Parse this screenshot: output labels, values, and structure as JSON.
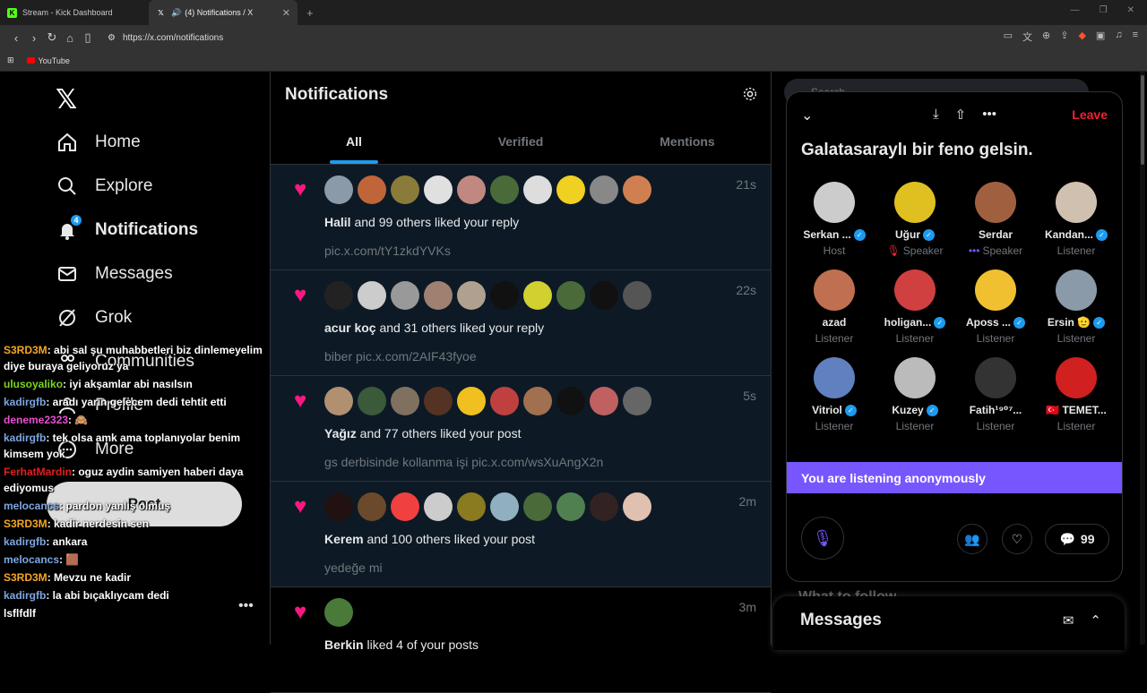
{
  "browser": {
    "tabs": [
      {
        "title": "Stream - Kick Dashboard",
        "favicon": "K",
        "favicon_color": "#53fc18"
      },
      {
        "title": "(4) Notifications / X",
        "favicon": "X",
        "favicon_color": "#ffffff"
      }
    ],
    "url": "https://x.com/notifications",
    "bookmark": "YouTube"
  },
  "nav": {
    "items": [
      {
        "label": "Home",
        "icon": "home-icon"
      },
      {
        "label": "Explore",
        "icon": "search-icon"
      },
      {
        "label": "Notifications",
        "icon": "bell-icon"
      },
      {
        "label": "Messages",
        "icon": "mail-icon"
      },
      {
        "label": "Grok",
        "icon": "grok-icon"
      },
      {
        "label": "Communities",
        "icon": "people-icon"
      },
      {
        "label": "Profile",
        "icon": "person-icon"
      },
      {
        "label": "More",
        "icon": "more-icon"
      }
    ],
    "notif_badge": "4",
    "post_label": "Post"
  },
  "chat": [
    {
      "user": "S3RD3M",
      "color": "#f5a623",
      "msg": ": abi sal şu muhabbetleri biz dinlemeyelim diye buraya geliyoruz ya"
    },
    {
      "user": "ulusoyaliko",
      "color": "#7ed321",
      "msg": ": iyi akşamlar abi nasılsın"
    },
    {
      "user": "kadirgfb",
      "color": "#7ea6e0",
      "msg": ": aradı yarın gelecem dedi tehtit etti"
    },
    {
      "user": "deneme2323",
      "color": "#e94fd1",
      "msg": ": 🙈"
    },
    {
      "user": "kadirgfb",
      "color": "#7ea6e0",
      "msg": ": tek olsa amk ama toplanıyolar benim kimsem yok"
    },
    {
      "user": "FerhatMardin",
      "color": "#e02020",
      "msg": ": oguz aydin samiyen haberi daya ediyomus"
    },
    {
      "user": "melocancs",
      "color": "#7ea6e0",
      "msg": ": pardon yanlış olmuş"
    },
    {
      "user": "S3RD3M",
      "color": "#f5a623",
      "msg": ": kadir nerdesin sen"
    },
    {
      "user": "kadirgfb",
      "color": "#7ea6e0",
      "msg": ": ankara"
    },
    {
      "user": "melocancs",
      "color": "#7ea6e0",
      "msg": ": 🟫"
    },
    {
      "user": "S3RD3M",
      "color": "#f5a623",
      "msg": ": Mevzu ne kadir"
    },
    {
      "user": "kadirgfb",
      "color": "#7ea6e0",
      "msg": ": la abi bıçaklıycam dedi"
    },
    {
      "user": "",
      "color": "#ffffff",
      "msg": "lsflfdlf"
    }
  ],
  "main": {
    "title": "Notifications",
    "tabs": [
      "All",
      "Verified",
      "Mentions"
    ],
    "notifications": [
      {
        "name": "Halil",
        "rest": " and 99 others liked your reply",
        "sub": "pic.x.com/tY1zkdYVKs",
        "time": "21s",
        "avatars": [
          "#8a9aa8",
          "#c0653a",
          "#8a7b3a",
          "#e0e0e0",
          "#c08880",
          "#4a6a3a",
          "#ddd",
          "#f0d020",
          "#888",
          "#d08050"
        ]
      },
      {
        "name": "acur koç",
        "rest": " and 31 others liked your reply",
        "sub": "biber pic.x.com/2AIF43fyoe",
        "time": "22s",
        "avatars": [
          "#222",
          "#ccc",
          "#999",
          "#a08070",
          "#b0a090",
          "#111",
          "#d0d030",
          "#4a6a3a",
          "#111",
          "#555"
        ]
      },
      {
        "name": "Yağız",
        "rest": " and 77 others liked your post",
        "sub": "gs derbisinde kollanma işi pic.x.com/wsXuAngX2n",
        "time": "5s",
        "avatars": [
          "#b09070",
          "#3a5a3a",
          "#807060",
          "#553322",
          "#f0c020",
          "#c04040",
          "#a07050",
          "#111",
          "#c06060",
          "#666"
        ]
      },
      {
        "name": "Kerem",
        "rest": " and 100 others liked your post",
        "sub": "yedeğe mi",
        "time": "2m",
        "avatars": [
          "#221111",
          "#6a4a2a",
          "#f04040",
          "#ccc",
          "#8a7a20",
          "#90b0c0",
          "#4a6a3a",
          "#508050",
          "#332222",
          "#e0c0b0"
        ]
      },
      {
        "name": "Berkin",
        "rest": " liked 4 of your posts",
        "sub": "",
        "time": "3m",
        "avatars": [
          "#4a7a3a"
        ]
      }
    ]
  },
  "space": {
    "search_placeholder": "Search",
    "leave": "Leave",
    "title": "Galatasaraylı bir feno gelsin.",
    "people": [
      {
        "name": "Serkan ...",
        "role": "Host",
        "verified": true,
        "color": "#ccc"
      },
      {
        "name": "Uğur",
        "role": "Speaker",
        "verified": true,
        "color": "#e0c020",
        "role_prefix": "🎙"
      },
      {
        "name": "Serdar",
        "role": "Speaker",
        "verified": false,
        "color": "#a06040",
        "role_prefix": "•••"
      },
      {
        "name": "Kandan...",
        "role": "Listener",
        "verified": true,
        "color": "#d0c0b0"
      },
      {
        "name": "azad",
        "role": "Listener",
        "verified": false,
        "color": "#c07050"
      },
      {
        "name": "holigan...",
        "role": "Listener",
        "verified": true,
        "color": "#d04040"
      },
      {
        "name": "Aposs ...",
        "role": "Listener",
        "verified": true,
        "color": "#f0c030"
      },
      {
        "name": "Ersin 🫡",
        "role": "Listener",
        "verified": true,
        "color": "#8a9aa8"
      },
      {
        "name": "Vitriol",
        "role": "Listener",
        "verified": true,
        "color": "#6080c0"
      },
      {
        "name": "Kuzey",
        "role": "Listener",
        "verified": true,
        "color": "#bbb"
      },
      {
        "name": "Fatih¹⁹⁰⁷...",
        "role": "Listener",
        "verified": false,
        "color": "#333"
      },
      {
        "name": "🇹🇷 TEMET...",
        "role": "Listener",
        "verified": false,
        "color": "#d02020"
      }
    ],
    "anon_text": "You are listening anonymously",
    "reply_count": "99"
  },
  "who_to_follow": "What to follow",
  "messages_title": "Messages"
}
